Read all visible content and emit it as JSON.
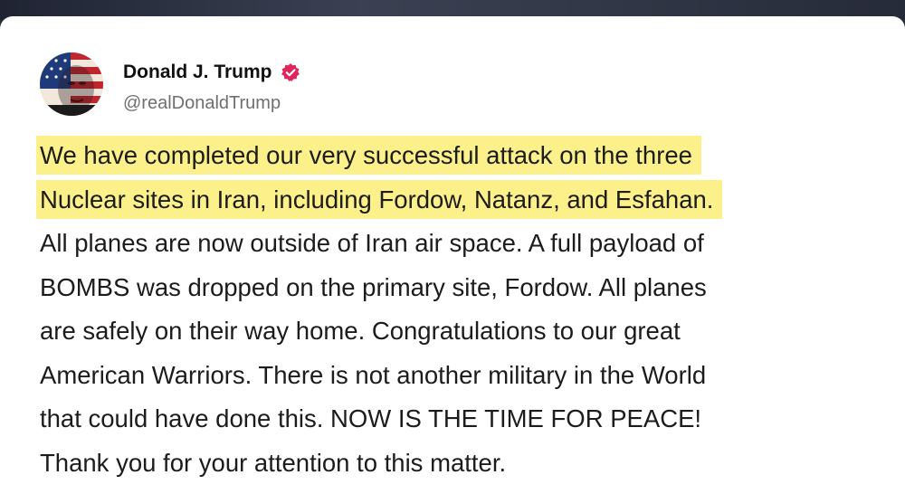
{
  "post": {
    "author_name": "Donald J. Trump",
    "author_handle": "@realDonaldTrump",
    "verified_icon": "verified-badge-icon",
    "avatar_icon": "avatar",
    "colors": {
      "highlight": "#fbf089",
      "verified": "#e0245e",
      "text": "#1c1c1c",
      "handle": "#6f6f6f"
    },
    "highlighted_lines": [
      "We have completed our very successful attack on the three",
      "Nuclear sites in Iran, including Fordow, Natanz, and Esfahan."
    ],
    "lines": [
      "All planes are now outside of Iran air space. A full payload of",
      "BOMBS was dropped on the primary site, Fordow. All planes",
      "are safely on their way home. Congratulations to our great",
      "American Warriors. There is not another military in the World",
      "that could have done this. NOW IS THE TIME FOR PEACE!",
      "Thank you for your attention to this matter."
    ]
  }
}
